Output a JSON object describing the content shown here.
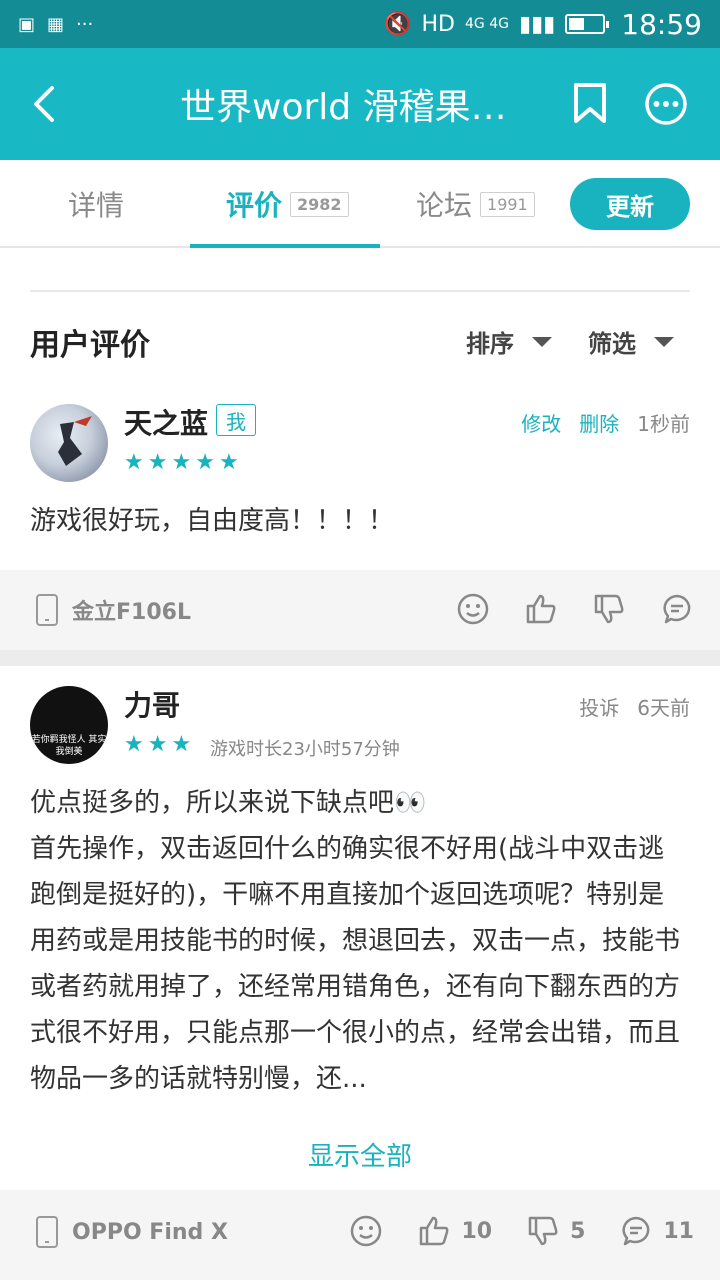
{
  "status_bar": {
    "left_icons": [
      "image-icon",
      "app-grid-icon",
      "more-dots-icon"
    ],
    "right": {
      "hd": "HD",
      "network": "4G 4G",
      "time": "18:59"
    }
  },
  "app_bar": {
    "title": "世界world 滑稽果传…"
  },
  "tabs": [
    {
      "label": "详情",
      "count": ""
    },
    {
      "label": "评价",
      "count": "2982"
    },
    {
      "label": "论坛",
      "count": "1991"
    }
  ],
  "update_button": "更新",
  "section": {
    "title": "用户评价",
    "sort": "排序",
    "filter": "筛选"
  },
  "reviews": [
    {
      "user": "天之蓝",
      "badge": "我",
      "rating": 5,
      "edit": "修改",
      "delete": "删除",
      "time": "1秒前",
      "text": "游戏很好玩，自由度高！！！！",
      "device": "金立F106L",
      "likes": "",
      "dislikes": "",
      "comments": ""
    },
    {
      "user": "力哥",
      "avatar_caption": "若你羁我怪人 其实我倒美",
      "rating": 3,
      "report": "投诉",
      "time": "6天前",
      "playtime": "游戏时长23小时57分钟",
      "text_lines": [
        "优点挺多的，所以来说下缺点吧👀",
        "首先操作，双击返回什么的确实很不好用(战斗中双击逃跑倒是挺好的)，干嘛不用直接加个返回选项呢？特别是用药或是用技能书的时候，想退回去，双击一点，技能书或者药就用掉了，还经常用错角色，还有向下翻东西的方式很不好用，只能点那一个很小的点，经常会出错，而且物品一多的话就特别慢，还..."
      ],
      "show_all": "显示全部",
      "device": "OPPO Find X",
      "likes": "10",
      "dislikes": "5",
      "comments": "11"
    }
  ],
  "colors": {
    "accent": "#19b2bf",
    "app_bar": "#18b8c4",
    "status_bar": "#148c96"
  }
}
